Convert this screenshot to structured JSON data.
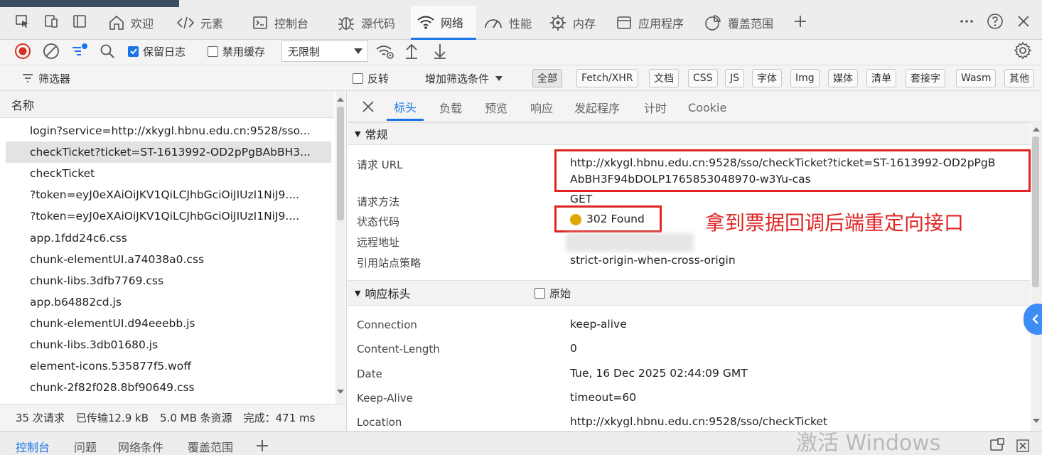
{
  "top_tabs": [
    {
      "label": "欢迎",
      "icon": "home-icon"
    },
    {
      "label": "元素",
      "icon": "code-icon"
    },
    {
      "label": "控制台",
      "icon": "console-icon"
    },
    {
      "label": "源代码",
      "icon": "bug-icon"
    },
    {
      "label": "网络",
      "icon": "wifi-icon",
      "active": true
    },
    {
      "label": "性能",
      "icon": "gauge-icon"
    },
    {
      "label": "内存",
      "icon": "gear-chip-icon"
    },
    {
      "label": "应用程序",
      "icon": "window-icon"
    },
    {
      "label": "覆盖范围",
      "icon": "pie-icon"
    }
  ],
  "toolbar": {
    "preserve_log": "保留日志",
    "disable_cache": "禁用缓存",
    "throttle": "无限制"
  },
  "filter": {
    "label": "筛选器",
    "invert": "反转",
    "more_filters": "增加筛选条件",
    "types": [
      "全部",
      "Fetch/XHR",
      "文档",
      "CSS",
      "JS",
      "字体",
      "Img",
      "媒体",
      "清单",
      "套接字",
      "Wasm",
      "其他"
    ]
  },
  "request_list": {
    "header": "名称",
    "rows": [
      "login?service=http://xkygl.hbnu.edu.cn:9528/sso...",
      "checkTicket?ticket=ST-1613992-OD2pPgBAbBH3...",
      "checkTicket",
      "?token=eyJ0eXAiOiJKV1QiLCJhbGciOiJIUzI1NiJ9....",
      "?token=eyJ0eXAiOiJKV1QiLCJhbGciOiJIUzI1NiJ9....",
      "app.1fdd24c6.css",
      "chunk-elementUI.a74038a0.css",
      "chunk-libs.3dfb7769.css",
      "app.b64882cd.js",
      "chunk-elementUI.d94eeebb.js",
      "chunk-libs.3db01680.js",
      "element-icons.535877f5.woff",
      "chunk-2f82f028.8bf90649.css"
    ],
    "selected_index": 1
  },
  "summary": {
    "requests": "35 次请求",
    "transferred": "已传输12.9 kB",
    "resources": "5.0 MB 条资源",
    "finish": "完成：471 ms"
  },
  "detail_tabs": [
    "标头",
    "负载",
    "预览",
    "响应",
    "发起程序",
    "计时",
    "Cookie"
  ],
  "general": {
    "title": "常规",
    "url_key": "请求 URL",
    "url_line1": "http://xkygl.hbnu.edu.cn:9528/sso/checkTicket?ticket=ST-1613992-OD2pPgB",
    "url_line2": "AbBH3F94bDOLP1765853048970-w3Yu-cas",
    "method_key": "请求方法",
    "method": "GET",
    "status_key": "状态代码",
    "status": "302 Found",
    "remote_key": "远程地址",
    "referrer_key": "引用站点策略",
    "referrer": "strict-origin-when-cross-origin"
  },
  "response_headers": {
    "title": "响应标头",
    "raw": "原始",
    "rows": [
      {
        "key": "Connection",
        "value": "keep-alive"
      },
      {
        "key": "Content-Length",
        "value": "0"
      },
      {
        "key": "Date",
        "value": "Tue, 16 Dec 2025 02:44:09 GMT"
      },
      {
        "key": "Keep-Alive",
        "value": "timeout=60"
      },
      {
        "key": "Location",
        "value": "http://xkygl.hbnu.edu.cn:9528/sso/checkTicket"
      }
    ]
  },
  "annotation": "拿到票据回调后端重定向接口",
  "drawer_tabs": [
    "控制台",
    "问题",
    "网络条件",
    "覆盖范围"
  ],
  "watermark": "激活 Windows",
  "colors": {
    "accent": "#1a73e8",
    "annotation": "#e02424",
    "status_dot": "#e0a800",
    "record": "#d93025"
  }
}
